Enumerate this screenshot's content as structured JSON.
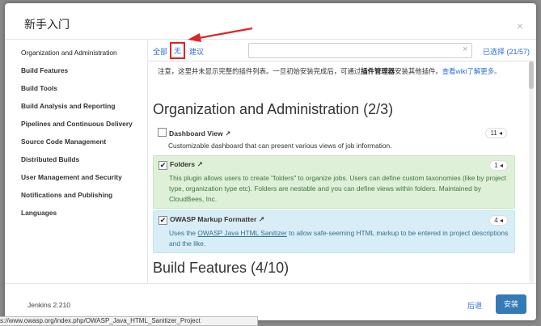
{
  "dialog": {
    "title": "新手入门",
    "close_glyph": "×"
  },
  "sidebar": {
    "items": [
      {
        "label": "Organization and Administration"
      },
      {
        "label": "Build Features"
      },
      {
        "label": "Build Tools"
      },
      {
        "label": "Build Analysis and Reporting"
      },
      {
        "label": "Pipelines and Continuous Delivery"
      },
      {
        "label": "Source Code Management"
      },
      {
        "label": "Distributed Builds"
      },
      {
        "label": "User Management and Security"
      },
      {
        "label": "Notifications and Publishing"
      },
      {
        "label": "Languages"
      }
    ]
  },
  "filter": {
    "all": "全部",
    "none": "无",
    "suggested": "建议",
    "search_value": "",
    "selected": "已选择 (21/57)"
  },
  "notice": {
    "text_1": "注意，这里并未显示完整的插件列表。一旦初始安装完成后，可通过",
    "bold": "插件管理器",
    "text_2": "安装其他插件。",
    "link": "查看wiki了解更多。"
  },
  "sections": [
    {
      "heading": "Organization and Administration (2/3)"
    },
    {
      "heading": "Build Features (4/10)"
    }
  ],
  "plugins": [
    {
      "name": "Dashboard View",
      "checked": false,
      "count": "11",
      "description": "Customizable dashboard that can present various views of job information."
    },
    {
      "name": "Folders",
      "checked": true,
      "count": "1",
      "description": "This plugin allows users to create \"folders\" to organize jobs. Users can define custom taxonomies (like by project type, organization type etc). Folders are nestable and you can define views within folders. Maintained by CloudBees, Inc."
    },
    {
      "name": "OWASP Markup Formatter",
      "checked": true,
      "count": "4",
      "desc_pre": "Uses the ",
      "desc_link": "OWASP Java HTML Sanitizer",
      "desc_post": " to allow safe-seeming HTML markup to be entered in project descriptions and the like."
    }
  ],
  "glyphs": {
    "external": "↗",
    "badge_arrow": "◂",
    "check": "✔",
    "search_clear": "×"
  },
  "footer": {
    "version": "Jenkins 2.210",
    "back": "后退",
    "install": "安装"
  },
  "statusbar": {
    "url": "s://www.owasp.org/index.php/OWASP_Java_HTML_Sanitizer_Project"
  },
  "colors": {
    "accent": "#337ab7",
    "link": "#2a6fd8",
    "highlight": "#e02424",
    "green_bg": "#dff0d8",
    "blue_bg": "#d9edf7"
  }
}
